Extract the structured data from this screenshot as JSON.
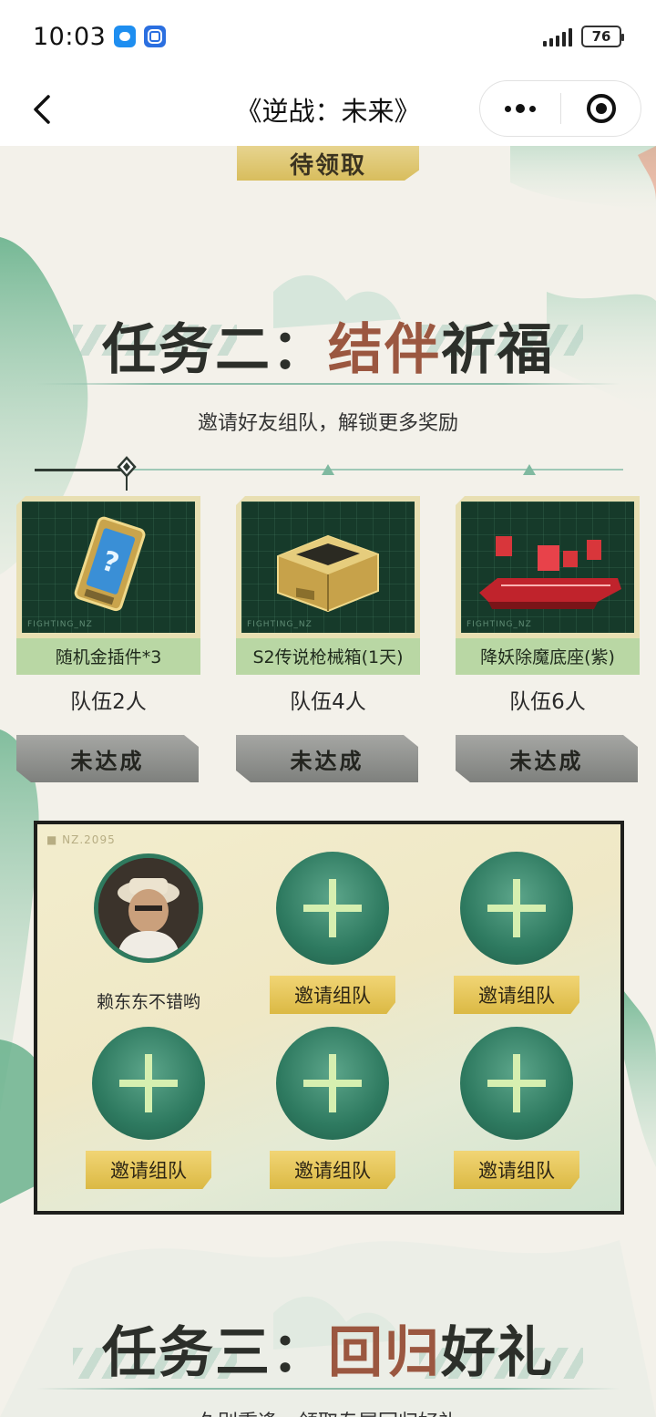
{
  "status_bar": {
    "time": "10:03",
    "battery": "76"
  },
  "nav": {
    "title": "《逆战：未来》"
  },
  "top_claim_label": "待领取",
  "task2": {
    "title_prefix": "任务二：",
    "title_highlight": "结伴",
    "title_suffix": "祈福",
    "subtitle": "邀请好友组队，解锁更多奖励",
    "rewards": [
      {
        "name": "随机金插件*3",
        "requirement": "队伍2人",
        "button": "未达成",
        "watermark": "FIGHTING_NZ"
      },
      {
        "name": "S2传说枪械箱(1天)",
        "requirement": "队伍4人",
        "button": "未达成",
        "watermark": "FIGHTING_NZ"
      },
      {
        "name": "降妖除魔底座(紫)",
        "requirement": "队伍6人",
        "button": "未达成",
        "watermark": "FIGHTING_NZ"
      }
    ]
  },
  "team_panel": {
    "tag": "NZ.2095",
    "member": {
      "name": "赖东东不错哟"
    },
    "invite_label": "邀请组队"
  },
  "task3": {
    "title_prefix": "任务三：",
    "title_highlight": "回归",
    "title_suffix": "好礼",
    "subtitle": "久别重逢，领取专属回归好礼"
  },
  "colors": {
    "accent_green": "#2e7a60",
    "accent_gold": "#dbb944",
    "title_red": "#9b5740"
  },
  "icons": [
    "back-arrow-icon",
    "more-dots-icon",
    "close-target-icon",
    "plus-icon",
    "question-card-icon",
    "weapon-box-icon",
    "pedestal-icon"
  ]
}
